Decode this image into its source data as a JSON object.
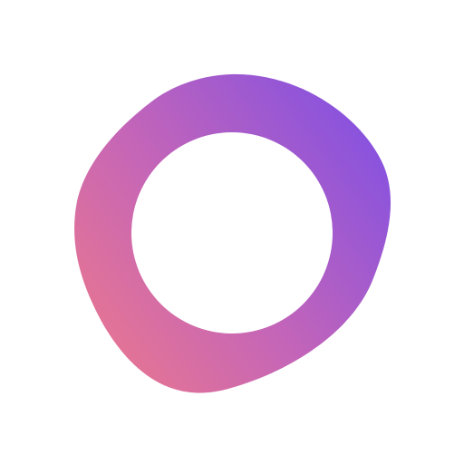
{
  "logo": {
    "name": "ring-logo-icon",
    "gradient": {
      "start_color": "#f07a88",
      "mid_color": "#c465b8",
      "end_color": "#8752df"
    },
    "background_color": "#ffffff",
    "hole_color": "#ffffff"
  }
}
